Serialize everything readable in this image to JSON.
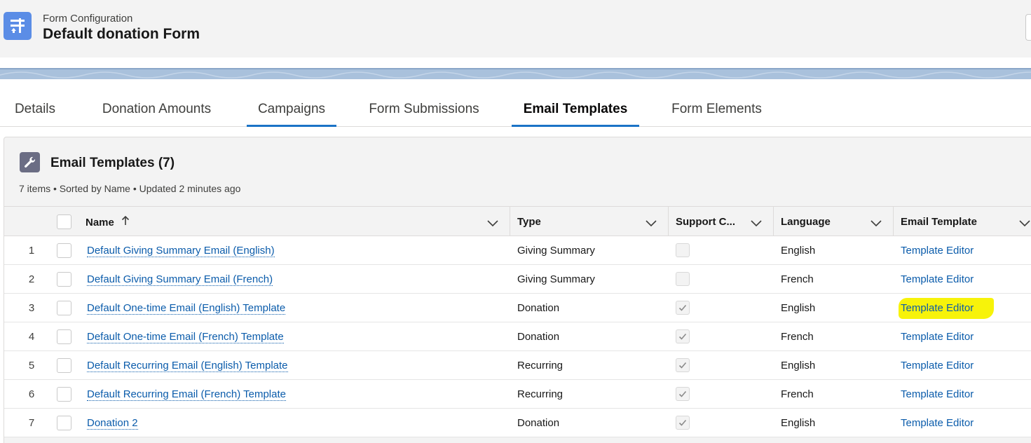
{
  "header": {
    "object_label": "Form Configuration",
    "record_title": "Default donation Form",
    "icon": "form-config-icon"
  },
  "tabs": [
    {
      "label": "Details"
    },
    {
      "label": "Donation Amounts"
    },
    {
      "label": "Campaigns"
    },
    {
      "label": "Form Submissions"
    },
    {
      "label": "Email Templates",
      "active": true
    },
    {
      "label": "Form Elements"
    }
  ],
  "related_list": {
    "icon": "wrench-icon",
    "title": "Email Templates (7)",
    "subtitle": "7 items • Sorted by Name • Updated 2 minutes ago",
    "columns": {
      "name": "Name",
      "type": "Type",
      "support": "Support C...",
      "language": "Language",
      "email_template": "Email Template"
    },
    "rows": [
      {
        "num": "1",
        "name": "Default Giving Summary Email (English)",
        "type": "Giving Summary",
        "support": false,
        "language": "English",
        "template": "Template Editor"
      },
      {
        "num": "2",
        "name": "Default Giving Summary Email (French)",
        "type": "Giving Summary",
        "support": false,
        "language": "French",
        "template": "Template Editor"
      },
      {
        "num": "3",
        "name": "Default One-time Email (English) Template",
        "type": "Donation",
        "support": true,
        "language": "English",
        "template": "Template Editor",
        "highlighted": true
      },
      {
        "num": "4",
        "name": "Default One-time Email (French) Template",
        "type": "Donation",
        "support": true,
        "language": "French",
        "template": "Template Editor"
      },
      {
        "num": "5",
        "name": "Default Recurring Email (English) Template",
        "type": "Recurring",
        "support": true,
        "language": "English",
        "template": "Template Editor"
      },
      {
        "num": "6",
        "name": "Default Recurring Email (French) Template",
        "type": "Recurring",
        "support": true,
        "language": "French",
        "template": "Template Editor"
      },
      {
        "num": "7",
        "name": "Donation 2",
        "type": "Donation",
        "support": true,
        "language": "English",
        "template": "Template Editor"
      }
    ]
  },
  "colors": {
    "link": "#0b5cab",
    "tab_underline": "#1b73c6",
    "highlight": "#f7f30a",
    "header_icon_bg": "#5b8de6"
  }
}
